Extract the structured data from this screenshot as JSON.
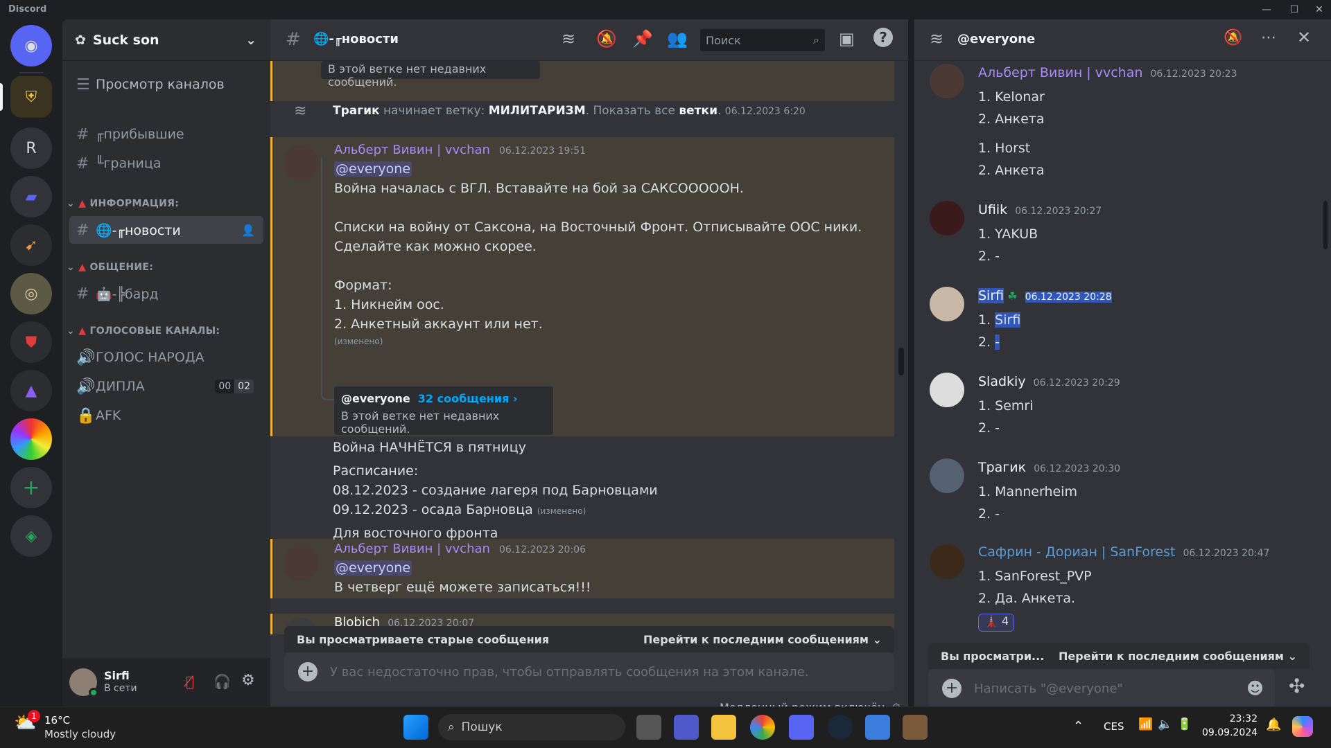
{
  "window": {
    "title": "Discord",
    "controls": [
      "—",
      "☐",
      "✕"
    ]
  },
  "rail": {
    "servers": [
      {
        "name": "home",
        "glyph": "◉"
      },
      {
        "name": "eagle-server",
        "glyph": "⛨"
      },
      {
        "name": "r-server",
        "glyph": "R"
      },
      {
        "name": "folder",
        "glyph": "▰"
      },
      {
        "name": "game-server",
        "glyph": "➹"
      },
      {
        "name": "round-server",
        "glyph": "◎"
      },
      {
        "name": "shield-server",
        "glyph": "⛊"
      },
      {
        "name": "tower-server",
        "glyph": "⚠"
      },
      {
        "name": "rainbow-server",
        "glyph": "●"
      }
    ],
    "add": "+",
    "discover": "◈"
  },
  "server": {
    "name": "Suck son",
    "browse": "Просмотр каналов",
    "top_channels": [
      {
        "icon": "#",
        "name": "╓прибывшие"
      },
      {
        "icon": "#",
        "name": "╙граница"
      }
    ],
    "categories": [
      {
        "name": "ИНФОРМАЦИЯ:",
        "channels": [
          {
            "icon": "#",
            "name": "🌐-╓новости",
            "selected": true
          }
        ]
      },
      {
        "name": "ОБЩЕНИЕ:",
        "channels": [
          {
            "icon": "#",
            "name": "🤖-╠бард"
          }
        ]
      },
      {
        "name": "ГОЛОСОВЫЕ КАНАЛЫ:",
        "channels": [
          {
            "icon": "🔊",
            "name": "ГОЛОС НАРОДА"
          },
          {
            "icon": "🔊",
            "name": "ДИПЛА",
            "badge_a": "00",
            "badge_b": "02"
          },
          {
            "icon": "🔒",
            "name": "AFK"
          }
        ]
      }
    ]
  },
  "user": {
    "name": "Sirfi",
    "status": "В сети"
  },
  "channel": {
    "name": "🌐-╓новости",
    "search_placeholder": "Поиск",
    "top_thread_note": "В этой ветке нет недавних сообщений.",
    "system": {
      "actor": "Трагик",
      "action": "начинает ветку:",
      "thread": "МИЛИТАРИЗМ",
      "show_all": ". Показать все",
      "threads_word": "ветки",
      "end": ".",
      "time": "06.12.2023 6:20"
    },
    "messages": [
      {
        "author": "Альберт Вивин | vvchan",
        "time": "06.12.2023 19:51",
        "mention": "@everyone",
        "lines": [
          "Война началась с ВГЛ. Вставайте на бой за САКСООООOН.",
          "",
          "Списки на войну от Саксона, на Восточный Фронт. Отписывайте ООС ники.",
          "Сделайте как можно скорее.",
          "",
          "Формат:",
          "1. Никнейм оос.",
          "2. Анкетный аккаунт или нет."
        ],
        "edited": "(изменено)",
        "thread_name": "@everyone",
        "thread_count": "32 сообщения ›",
        "thread_note": "В этой ветке нет недавних сообщений."
      }
    ],
    "followups": [
      "Война НАЧНЁТСЯ в пятницу",
      "Расписание:",
      "08.12.2023 - создание лагеря под Барновцами",
      "09.12.2023 - осада Барновца",
      "Для восточного фронта"
    ],
    "followup_edited": "(изменено)",
    "message2": {
      "author": "Альберт Вивин | vvchan",
      "time": "06.12.2023 20:06",
      "mention": "@everyone",
      "text": "В четверг ещё можете записаться!!!"
    },
    "partial": {
      "author": "Blobich",
      "time": "06.12.2023 20:07"
    },
    "old_bar": {
      "left": "Вы просматриваете старые сообщения",
      "right": "Перейти к последним сообщениям"
    },
    "composer_placeholder": "У вас недостаточно прав, чтобы отправлять сообщения на этом канале.",
    "slowmode": "Медленный режим включён."
  },
  "thread": {
    "title": "@everyone",
    "posts": [
      {
        "author": "Альберт Вивин | vvchan",
        "time": "06.12.2023 20:23",
        "color": "#a78bfa",
        "lines": [
          "1. Kelonar",
          "2. Анкета",
          "",
          "1. Horst",
          "2. Анкета"
        ]
      },
      {
        "author": "Ufiik",
        "time": "06.12.2023 20:27",
        "color": "#f2f3f5",
        "lines": [
          "1. YAKUB",
          "2. -"
        ]
      },
      {
        "author": "Sirfi",
        "time": "06.12.2023 20:28",
        "color": "#f2f3f5",
        "lines": [
          "1. Sirfi",
          "2. -"
        ],
        "selected": true
      },
      {
        "author": "Sladkiy",
        "time": "06.12.2023 20:29",
        "color": "#f2f3f5",
        "lines": [
          "1. Semri",
          "2. -"
        ]
      },
      {
        "author": "Трагик",
        "time": "06.12.2023 20:30",
        "color": "#f2f3f5",
        "lines": [
          "1. Mannerheim",
          "2. -"
        ]
      },
      {
        "author": "Сафрин - Дориан | SanForest",
        "time": "06.12.2023 20:47",
        "color": "#5b9bd5",
        "lines": [
          "1. SanForest_PVP",
          "2. Да. Анкета."
        ]
      }
    ],
    "reaction_count": "4",
    "old_bar": {
      "left": "Вы просматри...",
      "right": "Перейти к последним сообщениям"
    },
    "composer_placeholder": "Написать \"@everyone\""
  },
  "taskbar": {
    "weather_temp": "16°C",
    "weather_desc": "Mostly cloudy",
    "weather_badge": "1",
    "search": "Пошук",
    "lang": "CES",
    "time": "23:32",
    "date": "09.09.2024"
  }
}
